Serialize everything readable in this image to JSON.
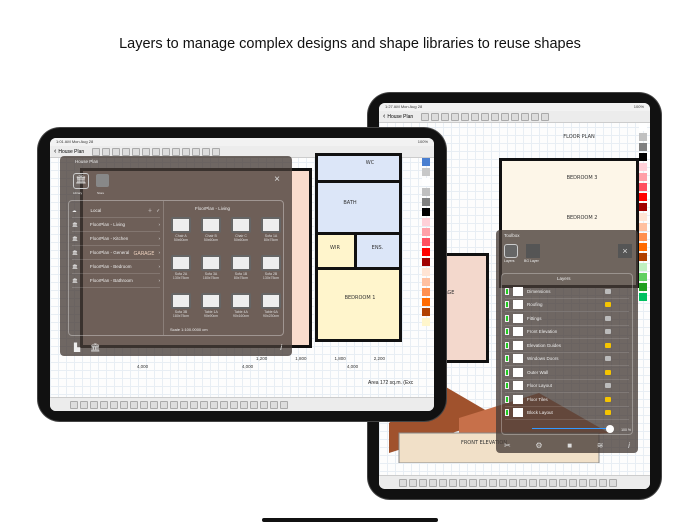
{
  "headline": "Layers to manage complex designs and shape libraries to reuse shapes",
  "back_ipad": {
    "status": {
      "time": "1:27 AM",
      "date": "Mon Aug 28",
      "battery": "100%"
    },
    "doc_title": "House Plan",
    "labels": {
      "floor_plan": "FLOOR PLAN",
      "bedroom3": "BEDROOM 3",
      "bedroom2": "BEDROOM 2",
      "garage": "GARAGE",
      "front_elevation": "FRONT ELEVATION"
    },
    "toolbox": {
      "title": "Toolbox",
      "tabs": [
        "Layers",
        "BG Layer"
      ],
      "layers_title": "Layers",
      "layers": [
        {
          "name": "Dimensions",
          "locked": false
        },
        {
          "name": "Roofing",
          "locked": true
        },
        {
          "name": "Fittings",
          "locked": false
        },
        {
          "name": "Front Elevation",
          "locked": false,
          "selected": true
        },
        {
          "name": "Elevation Guides",
          "locked": true
        },
        {
          "name": "Windows Doors",
          "locked": false
        },
        {
          "name": "Outer Wall",
          "locked": true
        },
        {
          "name": "Floor Layout",
          "locked": false
        },
        {
          "name": "Floor Tiles",
          "locked": true
        },
        {
          "name": "Block Layout",
          "locked": true
        }
      ],
      "opacity": "100 %"
    }
  },
  "front_ipad": {
    "status": {
      "time": "1:01 AM",
      "date": "Mon Aug 28",
      "battery": "100%"
    },
    "doc_title": "House Plan",
    "rooms": {
      "wc": "WC",
      "bath": "BATH",
      "wir": "WIR",
      "ens": "ENS.",
      "bedroom1": "BEDROOM 1",
      "garage": "GARAGE"
    },
    "dims": [
      "1,200",
      "1,800",
      "1,800",
      "2,200",
      "4,000",
      "4,000",
      "4,000"
    ],
    "area": "Area 172 sq.m. (Exc",
    "library": {
      "title": "House Plan",
      "tabs": [
        "Library",
        "Store"
      ],
      "local_title": "Local",
      "folders": [
        "FloorPlan - Living",
        "FloorPlan - Kitchen",
        "FloorPlan - General",
        "FloorPlan - Bedroom",
        "FloorPlan - Bathroom"
      ],
      "set_title": "FloorPlan - Living",
      "shapes": [
        {
          "name": "Chair A",
          "size": "50x60cm"
        },
        {
          "name": "Chair B",
          "size": "50x60cm"
        },
        {
          "name": "Chair C",
          "size": "50x60cm"
        },
        {
          "name": "Sofa 1A",
          "size": "80x75cm"
        },
        {
          "name": "Sofa 2A",
          "size": "130x75cm"
        },
        {
          "name": "Sofa 3A",
          "size": "180x75cm"
        },
        {
          "name": "Sofa 1B",
          "size": "80x75cm"
        },
        {
          "name": "Sofa 2B",
          "size": "130x75cm"
        },
        {
          "name": "Sofa 3B",
          "size": "180x75cm"
        },
        {
          "name": "Table 1A",
          "size": "90x90cm"
        },
        {
          "name": "Table 4A",
          "size": "90x160cm"
        },
        {
          "name": "Table 6A",
          "size": "90x230cm"
        }
      ],
      "scale": "Scale 1:100.0000  cm"
    }
  },
  "palette": [
    "#4a7fd0",
    "#c8c8c8",
    "#ffffff",
    "#c0c0c0",
    "#808080",
    "#000000",
    "#ffd0d8",
    "#ffa0a8",
    "#ff5060",
    "#ff0000",
    "#a00000",
    "#ffe4d4",
    "#ffc0a0",
    "#ff9050",
    "#ff6a00",
    "#b04000",
    "#fff6cc"
  ],
  "palette_back": [
    "#ffffff",
    "#c0c0c0",
    "#808080",
    "#000",
    "#ffd0d8",
    "#ffa0a8",
    "#ff5060",
    "#ff0000",
    "#a00000",
    "#ffe4d4",
    "#ffc0a0",
    "#ff9050",
    "#ff6a00",
    "#b04000",
    "#c0f0c0",
    "#60d060",
    "#20a020",
    "#00c060"
  ]
}
